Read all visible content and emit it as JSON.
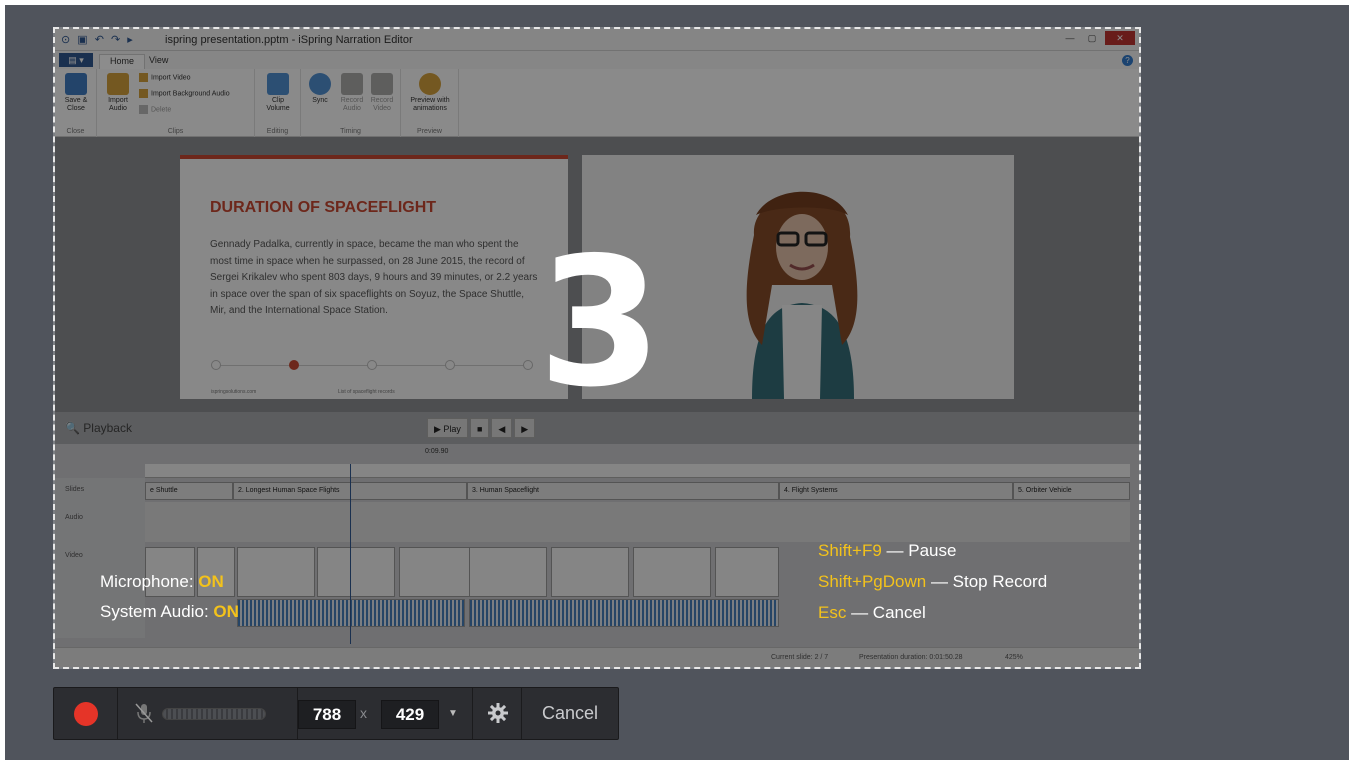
{
  "app": {
    "window_title": "ispring presentation.pptm - iSpring Narration Editor",
    "tabs": [
      "Home",
      "View"
    ],
    "ribbon": {
      "groups": [
        {
          "name": "Close",
          "buttons": [
            "Save & Close"
          ]
        },
        {
          "name": "Clips",
          "buttons": [
            "Import Audio"
          ],
          "small": [
            "Import Video",
            "Import Background Audio",
            "Delete"
          ]
        },
        {
          "name": "Editing",
          "buttons": [
            "Clip Volume"
          ]
        },
        {
          "name": "Timing",
          "buttons": [
            "Sync",
            "Record Audio",
            "Record Video"
          ]
        },
        {
          "name": "Preview",
          "buttons": [
            "Preview with animations"
          ]
        }
      ]
    },
    "slide": {
      "title": "DURATION OF SPACEFLIGHT",
      "body": "Gennady Padalka, currently in space, became the man who spent the most time in space when he surpassed, on 28 June 2015, the record of Sergei Krikalev who spent 803 days, 9 hours and 39 minutes, or 2.2 years in space over the span of six spaceflights on Soyuz, the Space Shuttle, Mir, and the International Space Station.",
      "footer_left": "ispringsolutions.com",
      "footer_right": "List of spaceflight records"
    },
    "playback_label": "Playback",
    "play_controls": [
      "▶ Play",
      "■",
      "◀",
      "▶"
    ],
    "timeline_time": "0:09.90",
    "track_labels": [
      "Slides",
      "Audio",
      "Video"
    ],
    "slide_segments": [
      "e Shuttle",
      "2. Longest Human Space Flights",
      "3. Human Spaceflight",
      "4. Flight Systems",
      "5. Orbiter Vehicle"
    ],
    "video_clips": [
      "video1.mp4",
      "video2.mp4"
    ],
    "status": {
      "current_slide": "Current slide: 2 / 7",
      "duration": "Presentation duration: 0:01:50.28",
      "zoom": "425%"
    }
  },
  "countdown": "3",
  "microphone": {
    "label": "Microphone:",
    "state": "ON"
  },
  "system_audio": {
    "label": "System Audio:",
    "state": "ON"
  },
  "hotkeys": [
    {
      "key": "Shift+F9",
      "action": "— Pause"
    },
    {
      "key": "Shift+PgDown",
      "action": "— Stop Record"
    },
    {
      "key": "Esc",
      "action": "— Cancel"
    }
  ],
  "recorder": {
    "width": "788",
    "separator": "x",
    "height": "429",
    "cancel_label": "Cancel",
    "record_color": "#e53428"
  },
  "colors": {
    "accent": "#f3c21b",
    "backdrop": "#50545c"
  }
}
